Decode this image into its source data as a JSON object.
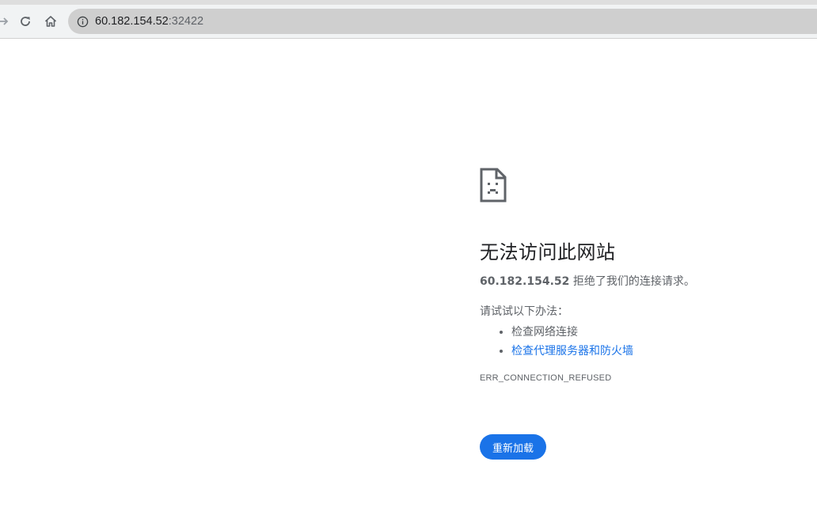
{
  "browser": {
    "url_host": "60.182.154.52",
    "url_port": ":32422",
    "icons": {
      "forward": "arrow-right-icon",
      "reload": "reload-icon",
      "home": "home-icon",
      "site_info": "info-icon"
    }
  },
  "error_page": {
    "icon": "sad-page-icon",
    "title": "无法访问此网站",
    "host": "60.182.154.52",
    "summary_suffix": " 拒绝了我们的连接请求。",
    "suggestions_heading": "请试试以下办法：",
    "suggestions": [
      {
        "label": "检查网络连接",
        "is_link": false
      },
      {
        "label": "检查代理服务器和防火墙",
        "is_link": true
      }
    ],
    "error_code": "ERR_CONNECTION_REFUSED",
    "reload_label": "重新加载",
    "colors": {
      "link": "#1a73e8",
      "button": "#1a73e8",
      "text": "#5f6368",
      "title": "#202124"
    }
  }
}
